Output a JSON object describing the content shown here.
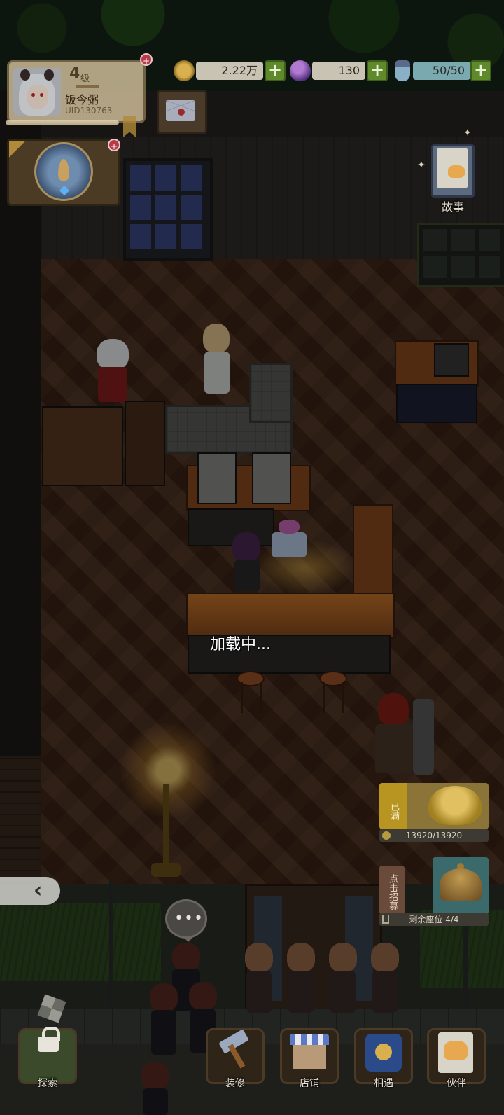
{
  "profile": {
    "level": "4",
    "level_unit": "级",
    "name": "饭今粥",
    "uid": "UID130763",
    "notification": "+"
  },
  "resources": {
    "gold": "2.22万",
    "gems": "130",
    "stamina": "50/50",
    "plus": "+"
  },
  "season": {
    "notification": "+"
  },
  "story": {
    "label": "故事"
  },
  "loading_text": "加载中...",
  "gold_panel": {
    "status": "已满",
    "count": "13920/13920"
  },
  "recruit": {
    "label": "点击招募",
    "seats": "剩余座位 4/4"
  },
  "chat": {
    "dots": "•••"
  },
  "collapse": {
    "arrow": "‹"
  },
  "nav": {
    "explore": "探索",
    "decorate": "装修",
    "shop": "店铺",
    "encounter": "相遇",
    "partner": "伙伴"
  },
  "icons": {
    "gold": "coin-icon",
    "gems": "gem-egg-icon",
    "stamina": "potion-icon",
    "mail": "envelope-icon",
    "season": "season-badge-icon",
    "story": "story-book-icon",
    "recruit": "bell-icon",
    "explore": "lock-icon",
    "decorate": "hammer-icon",
    "shop": "shop-icon",
    "encounter": "phone-icon",
    "partner": "cat-card-icon"
  },
  "colors": {
    "plus_button": "#5f8a2c",
    "gold_box": "#c9c3b3",
    "stamina_box": "#7aa9b0",
    "notification": "#b83a48"
  }
}
